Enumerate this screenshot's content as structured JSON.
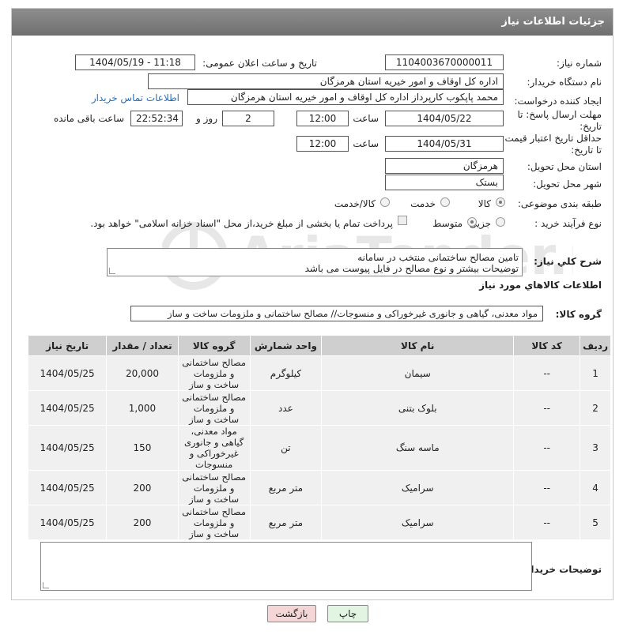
{
  "header": {
    "title": "جزئیات اطلاعات نیاز"
  },
  "fields": {
    "need_number_label": "شماره نیاز:",
    "need_number": "1104003670000011",
    "announce_label": "تاریخ و ساعت اعلان عمومی:",
    "announce_value": "1404/05/19 - 11:18",
    "buyer_org_label": "نام دستگاه خریدار:",
    "buyer_org": "اداره کل اوقاف و امور خیریه استان هرمزگان",
    "requester_label": "ایجاد کننده درخواست:",
    "requester": "محمد پاپکوب کارپرداز اداره کل اوقاف و امور خیریه استان هرمزگان",
    "contact_link": "اطلاعات تماس خریدار",
    "deadline_label_1": "مهلت ارسال پاسخ: تا",
    "deadline_label_2": "تاریخ:",
    "deadline_date": "1404/05/22",
    "time_label": "ساعت",
    "deadline_time": "12:00",
    "days_value": "2",
    "days_label": "روز و",
    "remaining_time": "22:52:34",
    "remaining_label": "ساعت باقی مانده",
    "price_validity_label_1": "حداقل تاریخ اعتبار قیمت:",
    "price_validity_label_2": "تا تاریخ:",
    "price_validity_date": "1404/05/31",
    "price_validity_time": "12:00",
    "delivery_province_label": "استان محل تحویل:",
    "delivery_province": "هرمزگان",
    "delivery_city_label": "شهر محل تحویل:",
    "delivery_city": "بستک",
    "category_label": "طبقه بندی موضوعی:",
    "category_options": [
      "کالا",
      "خدمت",
      "کالا/خدمت"
    ],
    "process_label": "نوع فرآیند خرید :",
    "process_options": [
      "جزیی",
      "متوسط"
    ],
    "payment_note": "پرداخت تمام یا بخشی از مبلغ خرید،از محل \"اسناد خزانه اسلامی\" خواهد بود.",
    "description_label": "شرح کلي نياز:",
    "description_line1": "تامین مصالح ساختمانی منتخب در سامانه",
    "description_line2": "توضیحات بیشتر و نوع مصالح در فایل پیوست می باشد",
    "goods_info_title": "اطلاعات کالاهاي مورد نياز",
    "goods_group_label": "گروه کالا:",
    "goods_group": "مواد معدنی، گیاهی و جانوری غیرخوراکی و منسوجات// مصالح ساختمانی و ملزومات ساخت و ساز",
    "buyer_notes_label": "توضیحات خریدار:"
  },
  "table": {
    "columns": [
      "ردیف",
      "کد کالا",
      "نام کالا",
      "واحد شمارش",
      "گروه کالا",
      "تعداد / مقدار",
      "تاریخ نیاز"
    ],
    "rows": [
      [
        "1",
        "--",
        "سیمان",
        "کیلوگرم",
        "مصالح ساختمانی و ملزومات ساخت و ساز",
        "20,000",
        "1404/05/25"
      ],
      [
        "2",
        "--",
        "بلوک بتنی",
        "عدد",
        "مصالح ساختمانی و ملزومات ساخت و ساز",
        "1,000",
        "1404/05/25"
      ],
      [
        "3",
        "--",
        "ماسه سنگ",
        "تن",
        "مواد معدنی، گیاهی و جانوری غیرخوراکی و منسوجات",
        "150",
        "1404/05/25"
      ],
      [
        "4",
        "--",
        "سرامیک",
        "متر مربع",
        "مصالح ساختمانی و ملزومات ساخت و ساز",
        "200",
        "1404/05/25"
      ],
      [
        "5",
        "--",
        "سرامیک",
        "متر مربع",
        "مصالح ساختمانی و ملزومات ساخت و ساز",
        "200",
        "1404/05/25"
      ]
    ]
  },
  "buttons": {
    "print": "چاپ",
    "back": "بازگشت"
  },
  "watermark": "AriaTender.neT",
  "colors": {
    "header": "#7d7d7d",
    "link": "#2a6fb8",
    "back_button": "#f5d6d6",
    "print_button": "#e2f5e2"
  }
}
